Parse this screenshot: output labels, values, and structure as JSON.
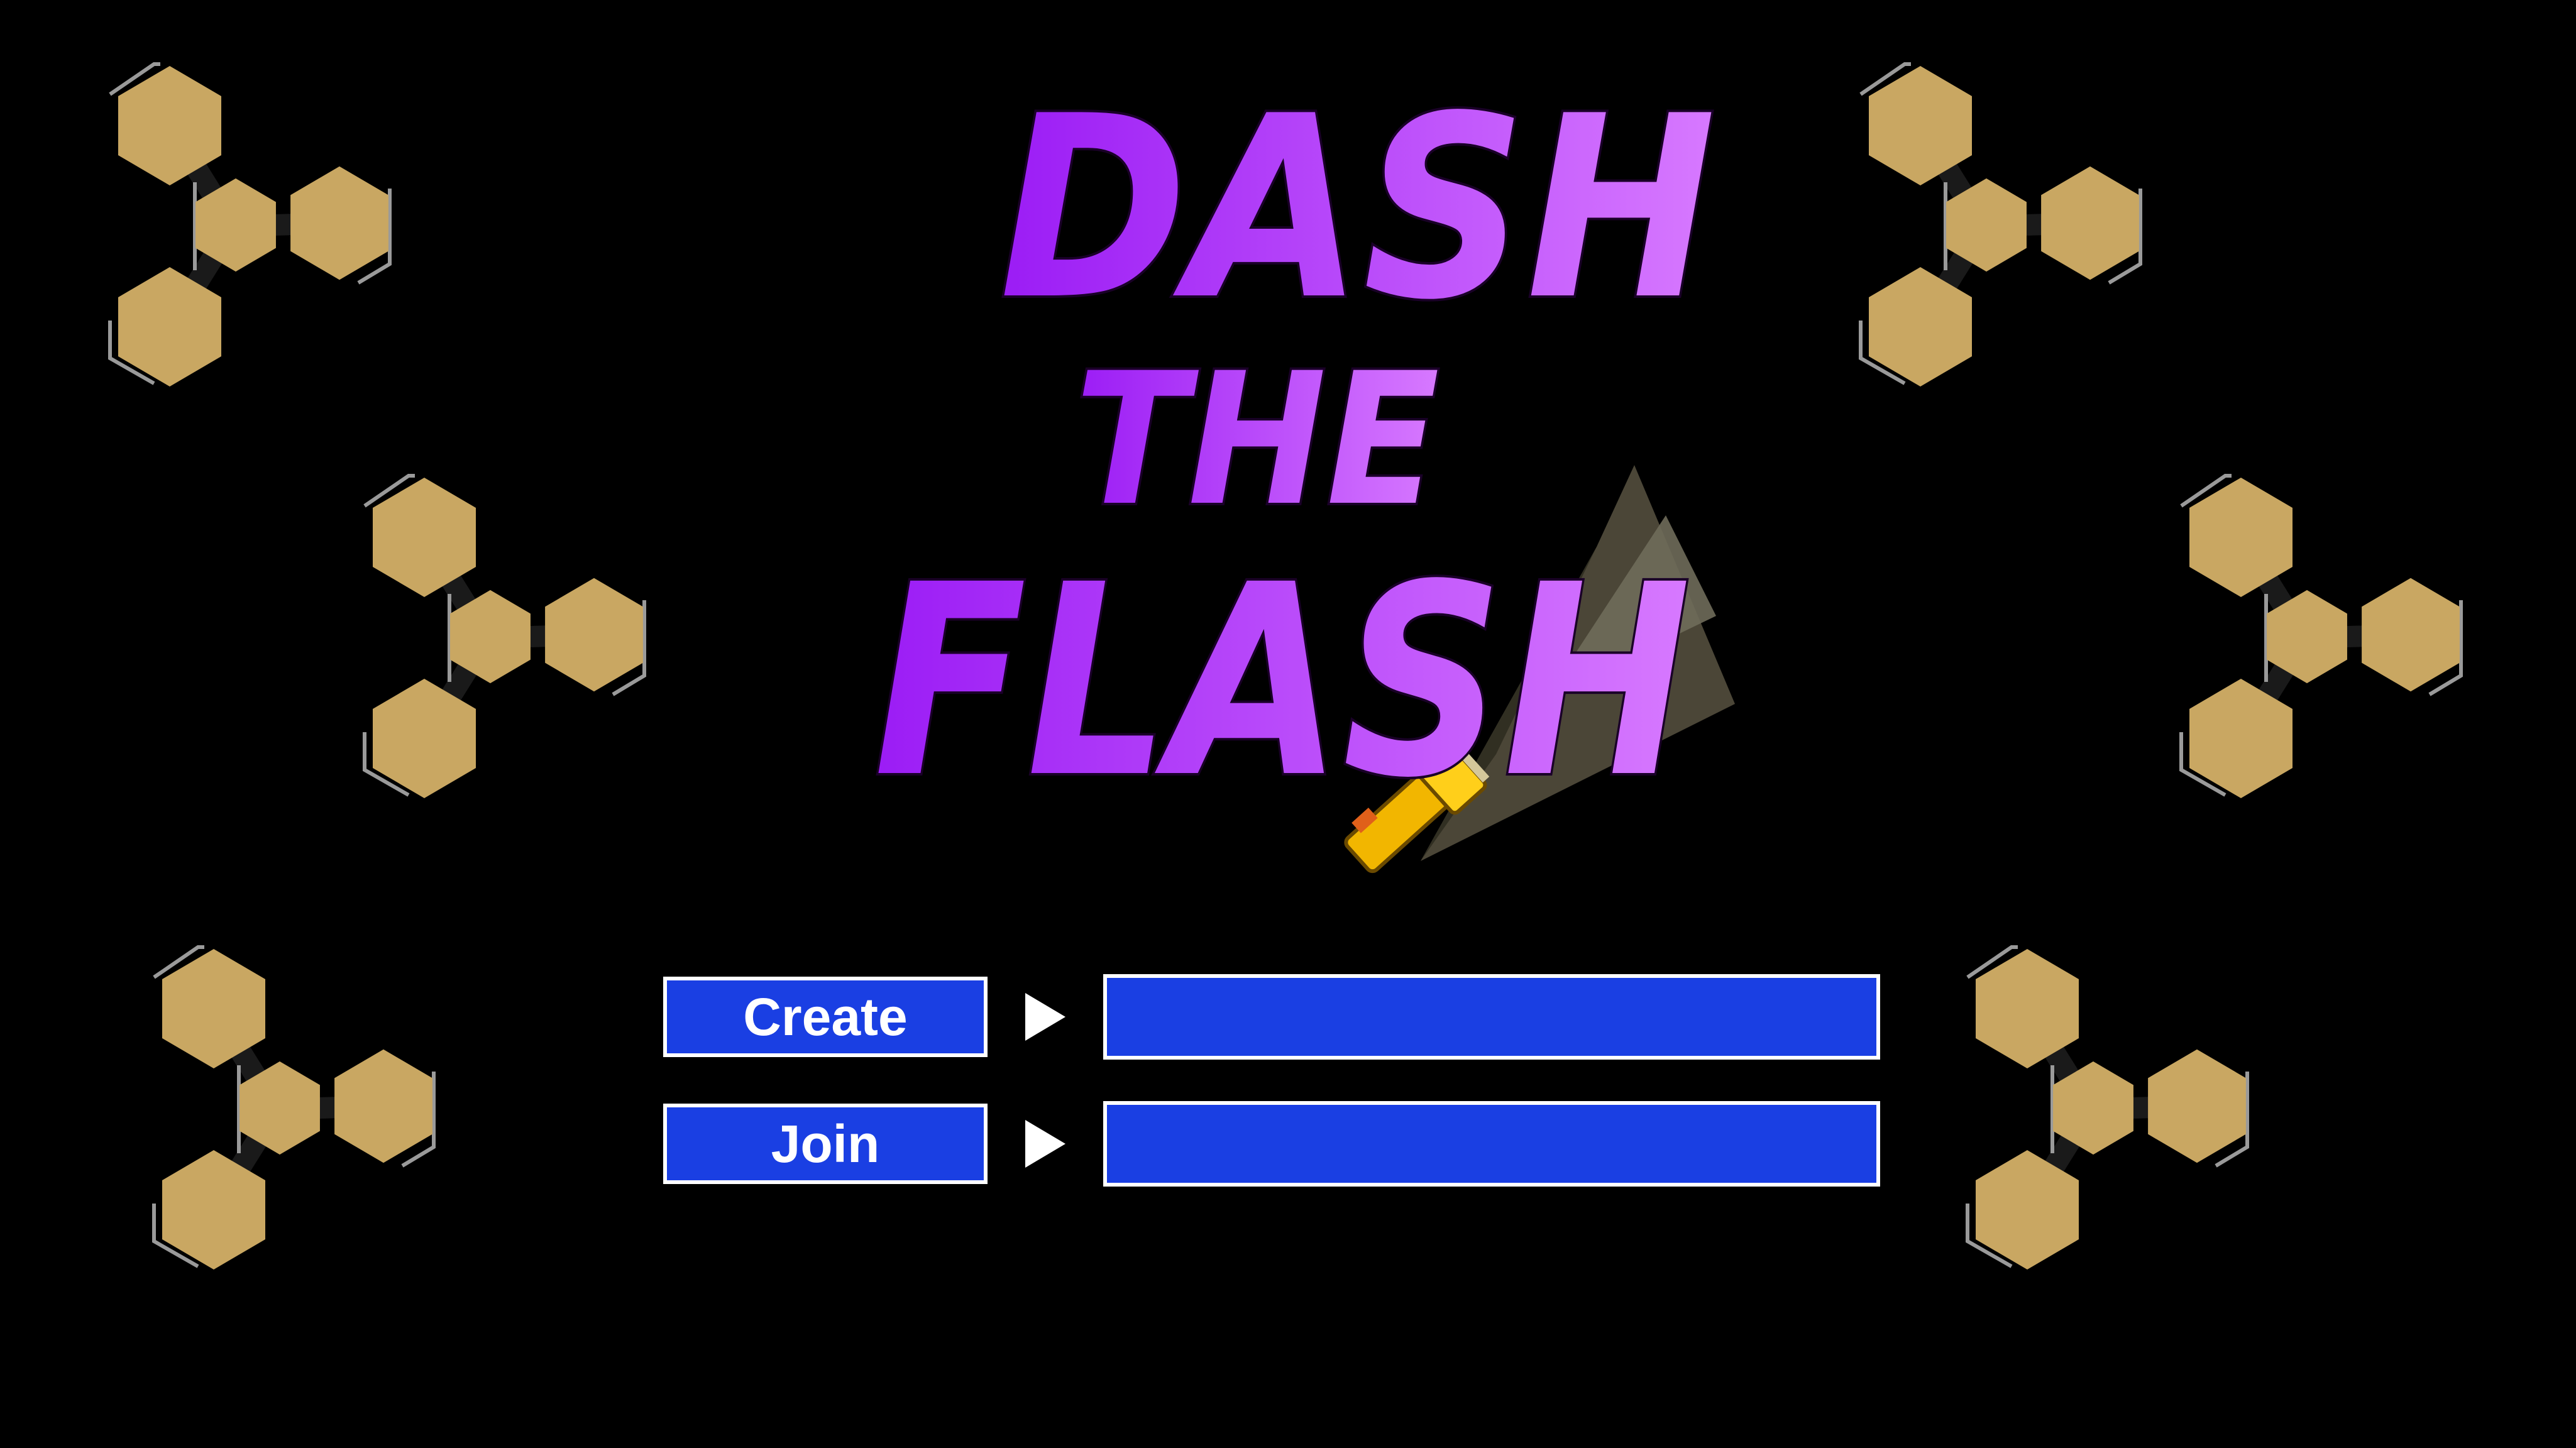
{
  "title": {
    "line1": "DASH",
    "line2": "THE",
    "line3": "FLASH"
  },
  "menu": {
    "create": {
      "label": "Create",
      "input_value": "",
      "input_placeholder": ""
    },
    "join": {
      "label": "Join",
      "input_value": "",
      "input_placeholder": ""
    }
  },
  "decor": {
    "hex_cluster_color": "#c9a762",
    "title_color_start": "#9b1cf5",
    "title_color_end": "#d779ff",
    "button_color": "#1a3fe3",
    "icons": [
      "hexagon-cluster-icon",
      "flashlight-icon",
      "play-arrow-icon"
    ]
  }
}
